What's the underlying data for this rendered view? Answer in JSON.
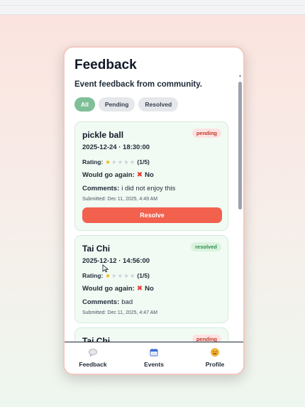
{
  "header": {
    "title": "Feedback",
    "subtitle": "Event feedback from community."
  },
  "filters": [
    {
      "label": "All",
      "active": true
    },
    {
      "label": "Pending",
      "active": false
    },
    {
      "label": "Resolved",
      "active": false
    }
  ],
  "cards": [
    {
      "title": "pickle ball",
      "status": "pending",
      "datetime": "2025-12-24 · 18:30:00",
      "rating_label": "Rating:",
      "rating": 1,
      "rating_text": "(1/5)",
      "again_label": "Would go again:",
      "again_value": "No",
      "comments_label": "Comments:",
      "comments": "i did not enjoy this",
      "submitted": "Submitted: Dec 11, 2025, 4:49 AM",
      "action": "Resolve"
    },
    {
      "title": "Tai Chi",
      "status": "resolved",
      "datetime": "2025-12-12 · 14:56:00",
      "rating_label": "Rating:",
      "rating": 1,
      "rating_text": "(1/5)",
      "again_label": "Would go again:",
      "again_value": "No",
      "comments_label": "Comments:",
      "comments": "bad",
      "submitted": "Submitted: Dec 11, 2025, 4:47 AM"
    },
    {
      "title": "Tai Chi",
      "status": "pending"
    }
  ],
  "nav": [
    {
      "label": "Feedback",
      "icon": "speech-bubble-icon"
    },
    {
      "label": "Events",
      "icon": "calendar-icon"
    },
    {
      "label": "Profile",
      "icon": "smiley-face-icon"
    }
  ],
  "colors": {
    "accent_green": "#7fbf98",
    "resolve_button": "#f2604e",
    "card_background": "#f1fbf3"
  }
}
